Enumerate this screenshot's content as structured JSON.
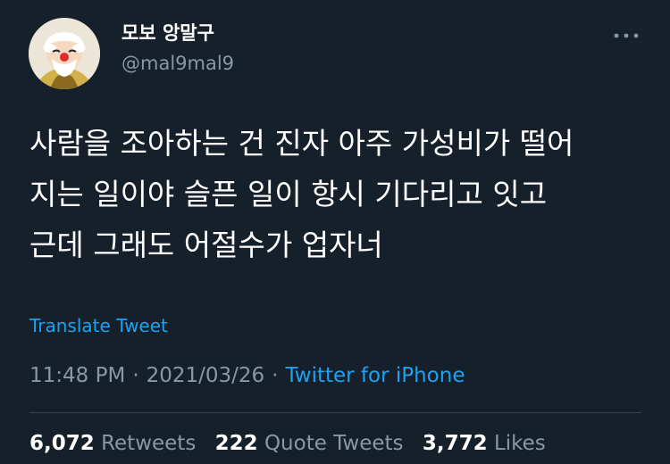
{
  "author": {
    "display_name": "모보 앙말구",
    "handle": "@mal9mal9",
    "avatar_icon": "cartoon-character-avatar-icon"
  },
  "menu": {
    "icon": "more-horizontal-icon"
  },
  "tweet": {
    "text_lines": [
      "사람을 조아하는 건 진자 아주 가성비가 떨어",
      "지는 일이야 슬픈 일이 항시 기다리고 잇고",
      "근데 그래도 어절수가 업자너"
    ],
    "translate_label": "Translate Tweet"
  },
  "meta": {
    "time": "11:48 PM",
    "separator": "·",
    "date": "2021/03/26",
    "source": "Twitter for iPhone"
  },
  "stats": {
    "retweets_count": "6,072",
    "retweets_label": "Retweets",
    "quotes_count": "222",
    "quotes_label": "Quote Tweets",
    "likes_count": "3,772",
    "likes_label": "Likes"
  },
  "colors": {
    "background": "#15202b",
    "text_primary": "#ffffff",
    "text_secondary": "#8899a6",
    "accent": "#1da1f2",
    "divider": "#38444d"
  }
}
